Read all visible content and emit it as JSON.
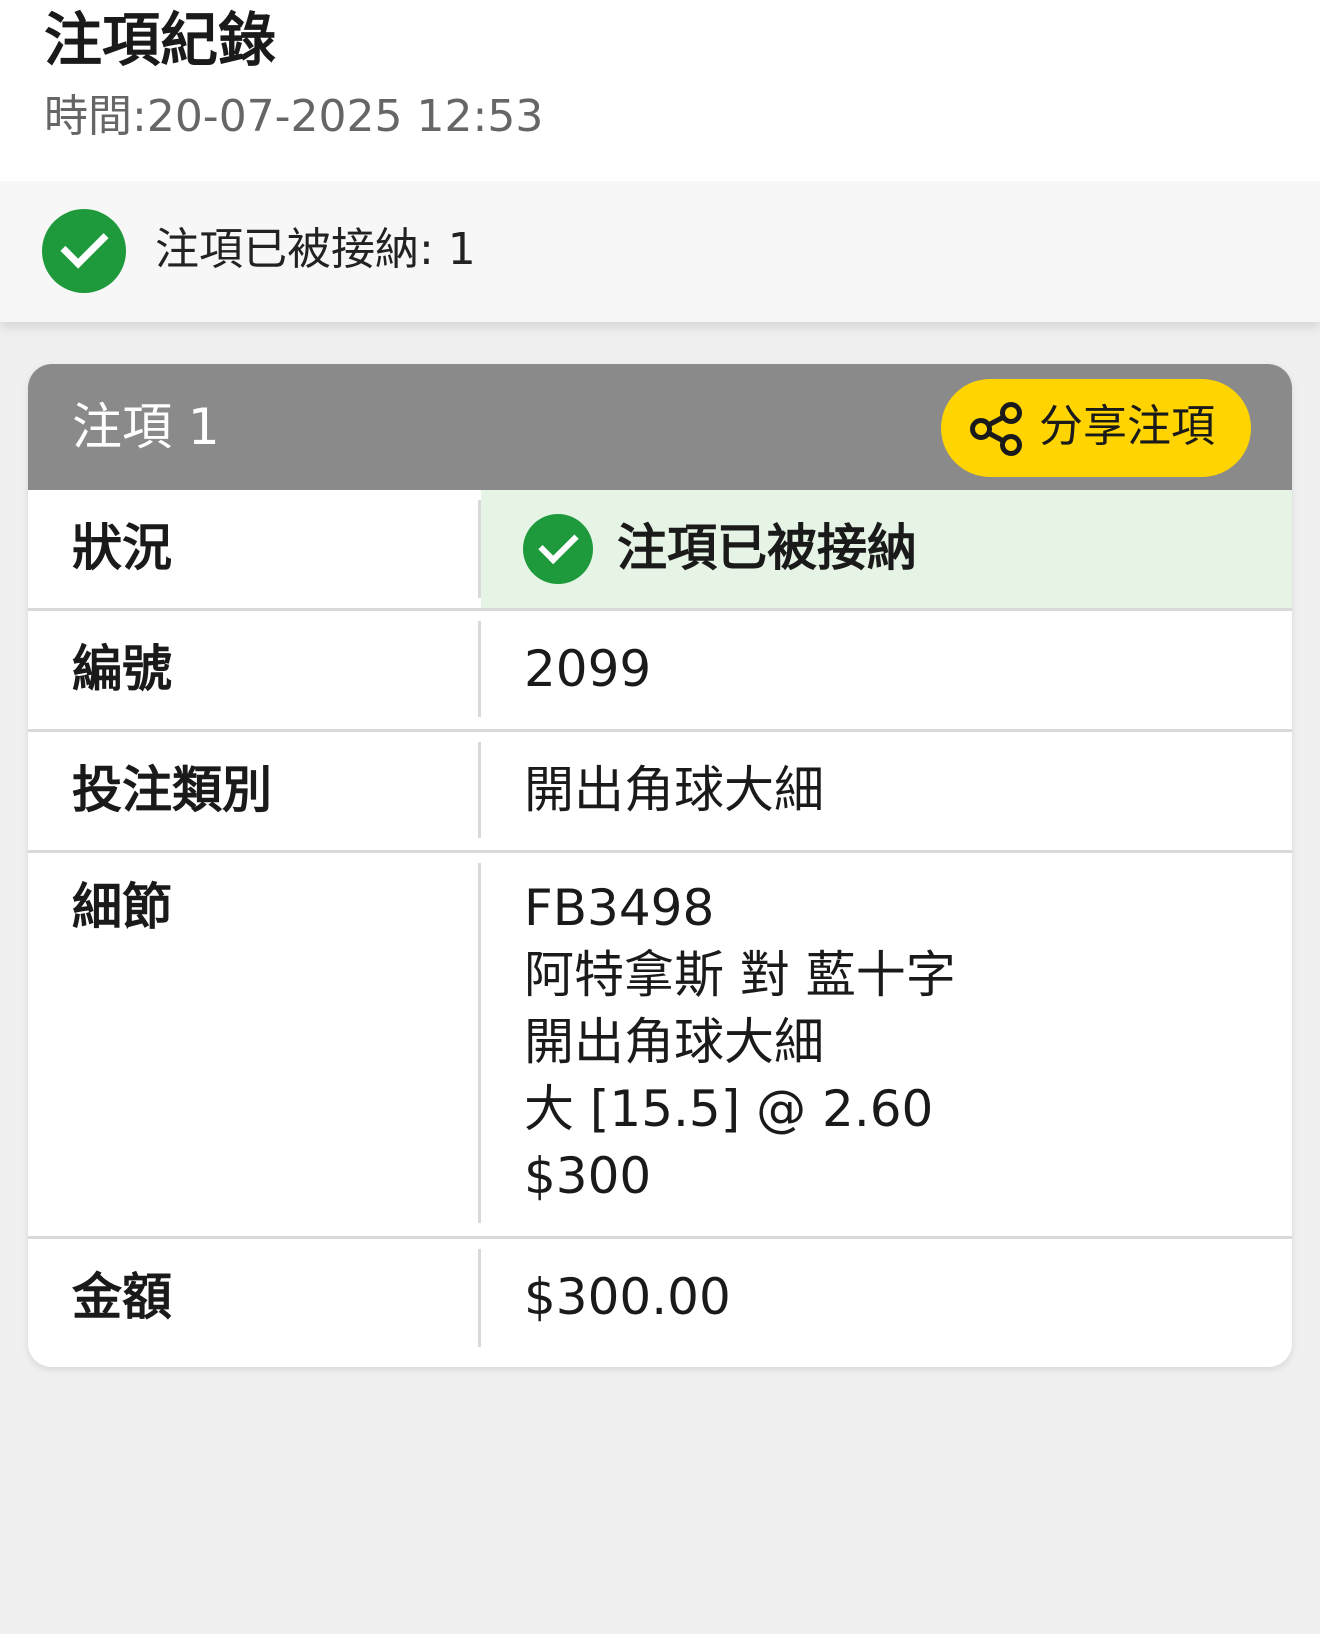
{
  "header": {
    "title": "注項紀錄",
    "timestamp": "時間:20-07-2025 12:53"
  },
  "summary": {
    "icon": "check-circle-icon",
    "text": "注項已被接納: 1",
    "accent_color": "#1e9a3d"
  },
  "bet_card": {
    "title": "注項 1",
    "share_button": {
      "icon": "share-icon",
      "label": "分享注項",
      "color": "#ffd400"
    },
    "rows": {
      "status": {
        "label": "狀況",
        "value": "注項已被接納",
        "icon": "check-circle-icon"
      },
      "number": {
        "label": "編號",
        "value": "2099"
      },
      "bet_type": {
        "label": "投注類別",
        "value": "開出角球大細"
      },
      "details": {
        "label": "細節",
        "lines": [
          "FB3498",
          "阿特拿斯 對 藍十字",
          "開出角球大細",
          "大 [15.5] @ 2.60",
          "$300"
        ]
      },
      "amount": {
        "label": "金額",
        "value": "$300.00"
      }
    }
  }
}
